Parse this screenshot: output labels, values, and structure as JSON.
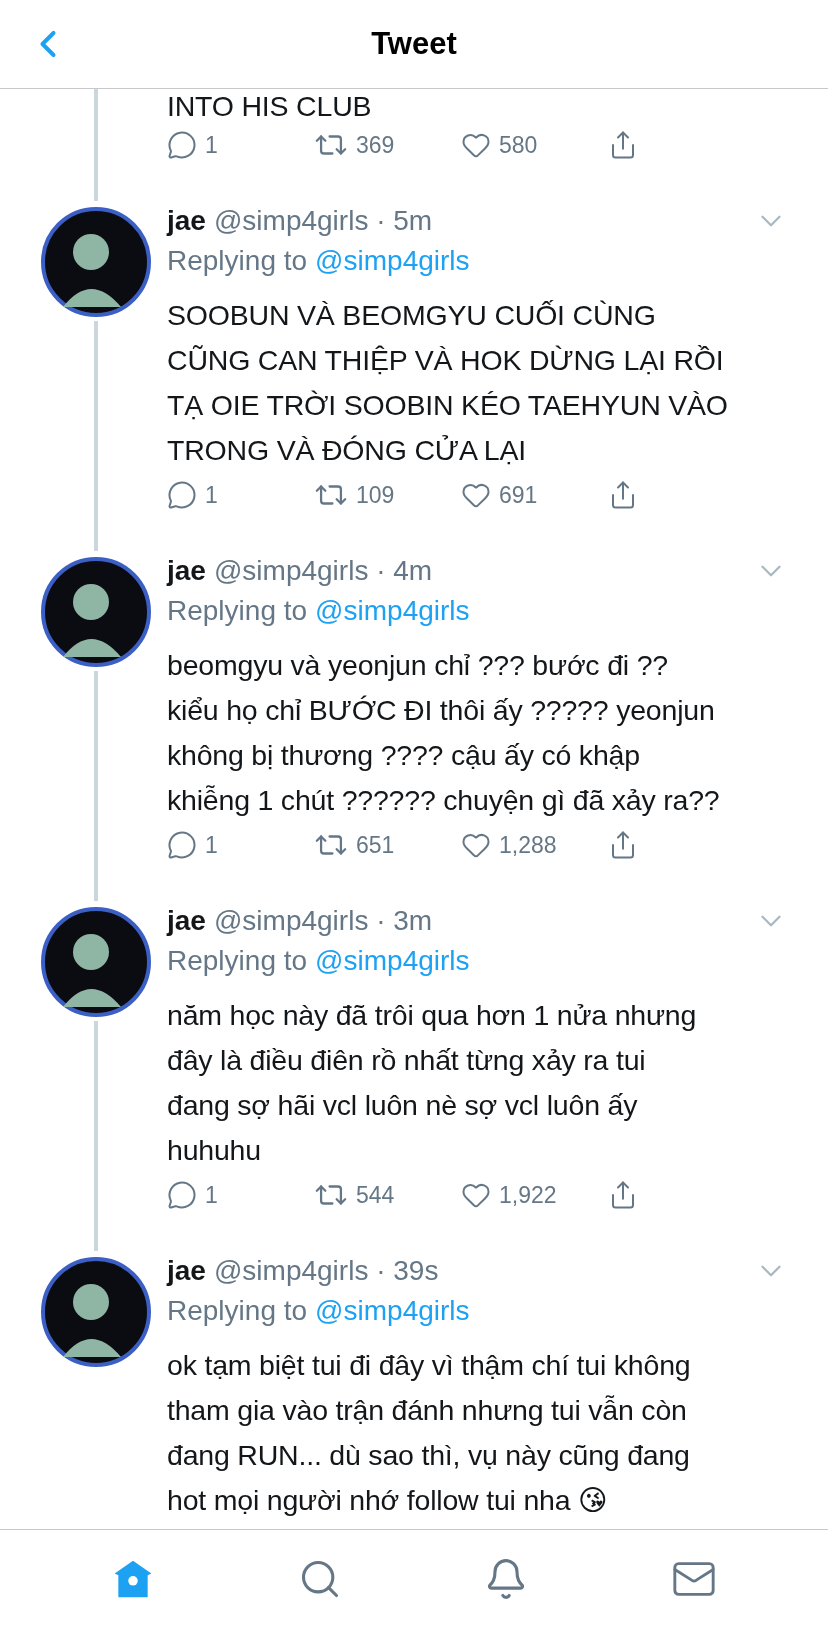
{
  "header": {
    "title": "Tweet"
  },
  "partial_tweet": {
    "text": "INTO HIS CLUB",
    "thread_continues": true,
    "actions": {
      "replies": "1",
      "retweets": "369",
      "likes": "580"
    }
  },
  "tweets": [
    {
      "name": "jae",
      "handle": "@simp4girls",
      "time": "· 5m",
      "replying_label": "Replying to",
      "replying_to": "@simp4girls",
      "text": "SOOBUN VÀ BEOMGYU CUỐI CÙNG\nCŨNG CAN THIỆP VÀ HOK DỪNG LẠI RỒI\nTẠ OIE TRỜI SOOBIN KÉO TAEHYUN VÀO\nTRONG VÀ ĐÓNG CỬA LẠI",
      "thread_continues": true,
      "actions": {
        "replies": "1",
        "retweets": "109",
        "likes": "691"
      }
    },
    {
      "name": "jae",
      "handle": "@simp4girls",
      "time": "· 4m",
      "replying_label": "Replying to",
      "replying_to": "@simp4girls",
      "text": "beomgyu và yeonjun chỉ ??? bước đi ??\nkiểu họ chỉ BƯỚC ĐI thôi ấy ????? yeonjun\nkhông bị thương ???? cậu ấy có khập\nkhiễng 1 chút ?????? chuyện gì đã xảy ra??",
      "thread_continues": true,
      "actions": {
        "replies": "1",
        "retweets": "651",
        "likes": "1,288"
      }
    },
    {
      "name": "jae",
      "handle": "@simp4girls",
      "time": "· 3m",
      "replying_label": "Replying to",
      "replying_to": "@simp4girls",
      "text": "năm học này đã trôi qua hơn 1 nửa nhưng\nđây là điều điên rồ nhất từng xảy ra tui\nđang sợ hãi vcl luôn nè sợ vcl luôn ấy\nhuhuhu",
      "thread_continues": true,
      "actions": {
        "replies": "1",
        "retweets": "544",
        "likes": "1,922"
      }
    },
    {
      "name": "jae",
      "handle": "@simp4girls",
      "time": "· 39s",
      "replying_label": "Replying to",
      "replying_to": "@simp4girls",
      "text": "ok tạm biệt tui đi đây vì thậm chí tui không\ntham gia vào trận đánh nhưng tui vẫn còn\nđang RUN... dù sao thì, vụ này cũng đang\nhot mọi người nhớ follow tui nha 😘",
      "thread_continues": false
    }
  ],
  "tab_bar": [
    {
      "kind": "home",
      "selected": true
    },
    {
      "kind": "search",
      "selected": false
    },
    {
      "kind": "notifications",
      "selected": false
    },
    {
      "kind": "messages",
      "selected": false
    }
  ]
}
